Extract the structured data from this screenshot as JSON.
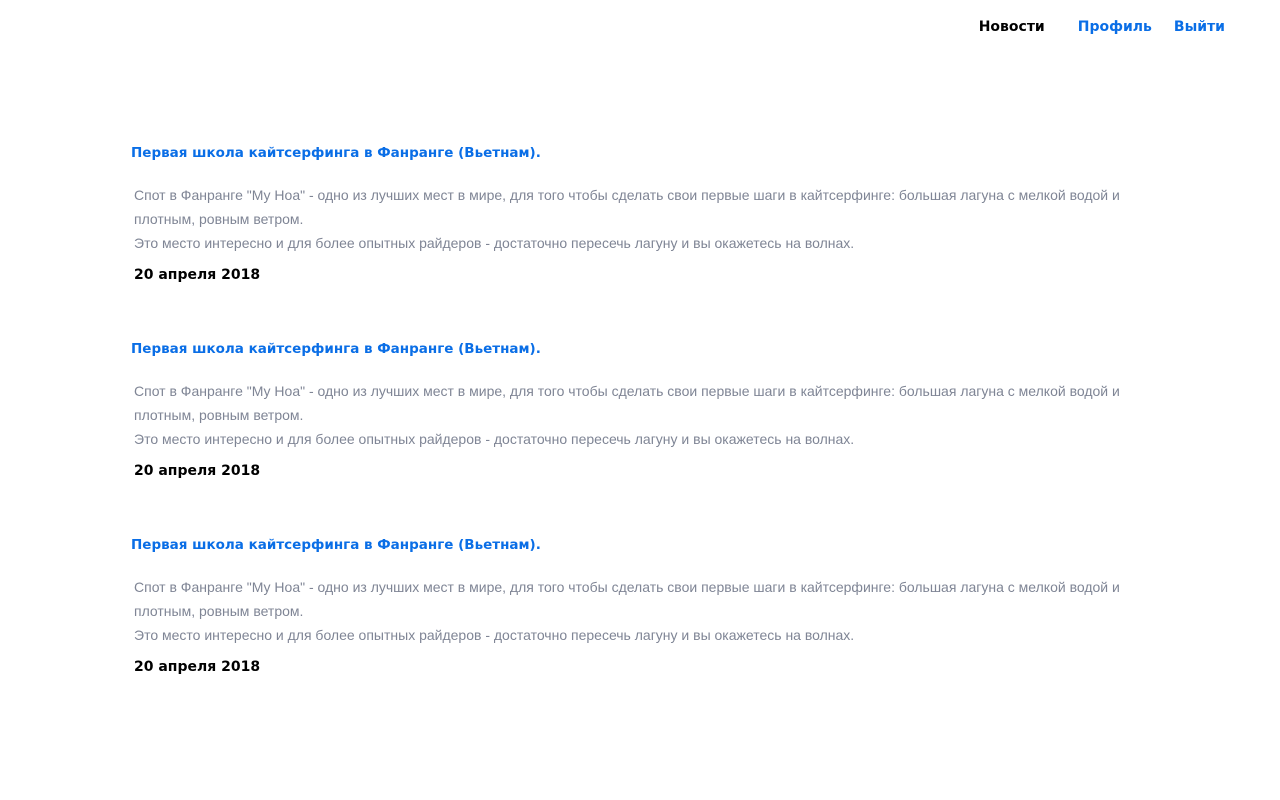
{
  "nav": {
    "news": "Новости",
    "profile": "Профиль",
    "logout": "Выйти"
  },
  "colors": {
    "link": "#0a6ee6",
    "body_text": "#7f8595",
    "active": "#000000"
  },
  "posts": [
    {
      "title": "Первая школа кайтсерфинга в Фанранге (Вьетнам).",
      "paragraphs": [
        "Спот в Фанранге \"Му Ноа\" - одно из лучших мест в мире, для того чтобы сделать свои первые шаги в кайтсерфинге: большая лагуна с мелкой водой и плотным, ровным ветром.",
        "Это место интересно и для более опытных райдеров - достаточно пересечь лагуну и вы окажетесь на волнах."
      ],
      "date": "20 апреля 2018"
    },
    {
      "title": "Первая школа кайтсерфинга в Фанранге (Вьетнам).",
      "paragraphs": [
        "Спот в Фанранге \"Му Ноа\" - одно из лучших мест в мире, для того чтобы сделать свои первые шаги в кайтсерфинге: большая лагуна с мелкой водой и плотным, ровным ветром.",
        "Это место интересно и для более опытных райдеров - достаточно пересечь лагуну и вы окажетесь на волнах."
      ],
      "date": "20 апреля 2018"
    },
    {
      "title": "Первая школа кайтсерфинга в Фанранге (Вьетнам).",
      "paragraphs": [
        "Спот в Фанранге \"Му Ноа\" - одно из лучших мест в мире, для того чтобы сделать свои первые шаги в кайтсерфинге: большая лагуна с мелкой водой и плотным, ровным ветром.",
        "Это место интересно и для более опытных райдеров - достаточно пересечь лагуну и вы окажетесь на волнах."
      ],
      "date": "20 апреля 2018"
    }
  ]
}
